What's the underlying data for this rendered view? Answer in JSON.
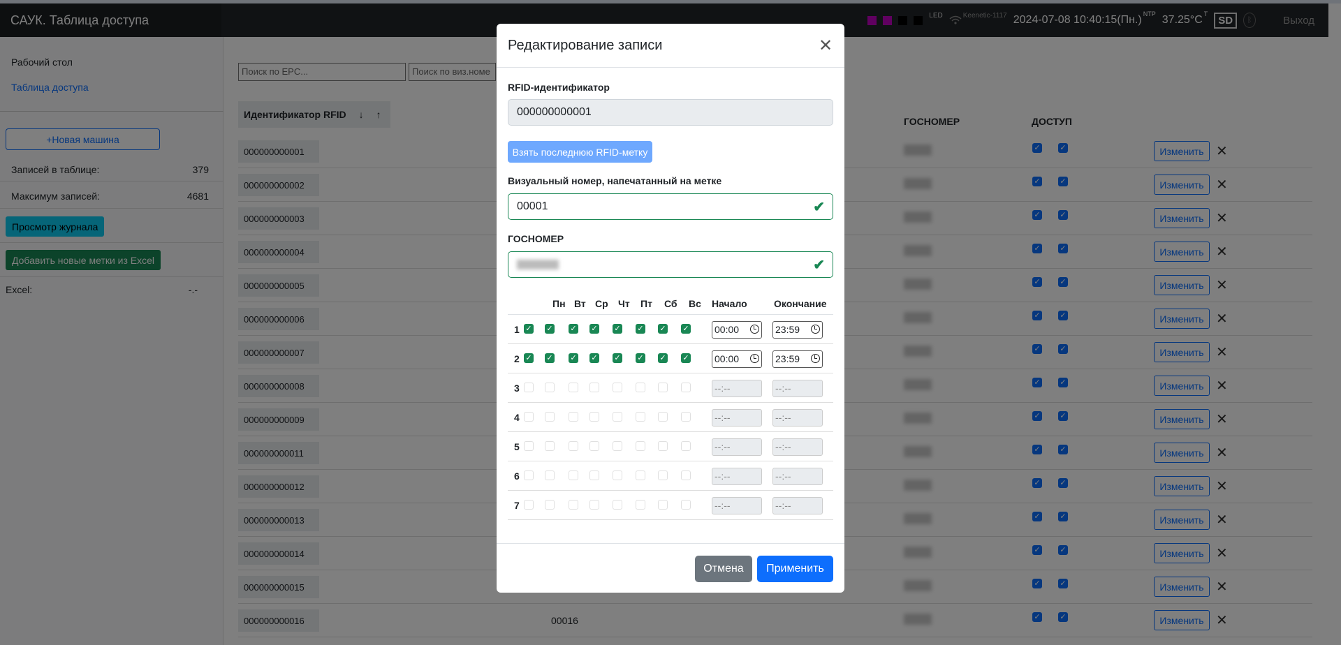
{
  "navbar": {
    "title": "САУК. Таблица доступа",
    "led_label": "LED",
    "wifi_name": "Keenetic-1117",
    "datetime": "2024-07-08 10:40:15(Пн.)",
    "ntp": "NTP",
    "temperature": "37.25°C",
    "temp_sup": "T",
    "sd": "SD",
    "logout": "Выход",
    "led_colors": [
      "#c000c0",
      "#c000c0",
      "#000000",
      "#000000"
    ]
  },
  "sidebar": {
    "desktop": "Рабочий стол",
    "access_table": "Таблица доступа",
    "new_car": "+Новая машина",
    "records_label": "Записей в таблице:",
    "records_value": "379",
    "max_label": "Максимум записей:",
    "max_value": "4681",
    "view_log": "Просмотр журнала",
    "add_excel": "Добавить новые метки из Excel",
    "excel_label": "Excel:",
    "excel_value": "-.-"
  },
  "table": {
    "search_epc_placeholder": "Поиск по EPC...",
    "search_viz_placeholder": "Поиск по виз.номе",
    "col_rfid": "Идентификатор RFID",
    "sort_down": "↓",
    "sort_up": "↑",
    "col_plate": "ГОСНОМЕР",
    "col_access": "ДОСТУП",
    "edit_label": "Изменить",
    "rows": [
      {
        "rfid": "000000000001",
        "viz": ""
      },
      {
        "rfid": "000000000002",
        "viz": ""
      },
      {
        "rfid": "000000000003",
        "viz": ""
      },
      {
        "rfid": "000000000004",
        "viz": ""
      },
      {
        "rfid": "000000000005",
        "viz": ""
      },
      {
        "rfid": "000000000006",
        "viz": ""
      },
      {
        "rfid": "000000000007",
        "viz": ""
      },
      {
        "rfid": "000000000008",
        "viz": ""
      },
      {
        "rfid": "000000000009",
        "viz": ""
      },
      {
        "rfid": "000000000011",
        "viz": ""
      },
      {
        "rfid": "000000000012",
        "viz": ""
      },
      {
        "rfid": "000000000013",
        "viz": ""
      },
      {
        "rfid": "000000000014",
        "viz": ""
      },
      {
        "rfid": "000000000015",
        "viz": ""
      },
      {
        "rfid": "000000000016",
        "viz": "00016"
      }
    ]
  },
  "modal": {
    "title": "Редактирование записи",
    "rfid_label": "RFID-идентификатор",
    "rfid_value": "000000000001",
    "take_last": "Взять последнюю RFID-метку",
    "visual_label": "Визуальный номер, напечатанный на метке",
    "visual_value": "00001",
    "plate_label": "ГОСНОМЕР",
    "days": [
      "Пн",
      "Вт",
      "Ср",
      "Чт",
      "Пт",
      "Сб",
      "Вс"
    ],
    "start_label": "Начало",
    "end_label": "Окончание",
    "schedule": [
      {
        "n": "1",
        "enabled": true,
        "start": "00:00",
        "end": "23:59"
      },
      {
        "n": "2",
        "enabled": true,
        "start": "00:00",
        "end": "23:59"
      },
      {
        "n": "3",
        "enabled": false,
        "start": "--:--",
        "end": "--:--"
      },
      {
        "n": "4",
        "enabled": false,
        "start": "--:--",
        "end": "--:--"
      },
      {
        "n": "5",
        "enabled": false,
        "start": "--:--",
        "end": "--:--"
      },
      {
        "n": "6",
        "enabled": false,
        "start": "--:--",
        "end": "--:--"
      },
      {
        "n": "7",
        "enabled": false,
        "start": "--:--",
        "end": "--:--"
      }
    ],
    "cancel": "Отмена",
    "apply": "Применить"
  }
}
